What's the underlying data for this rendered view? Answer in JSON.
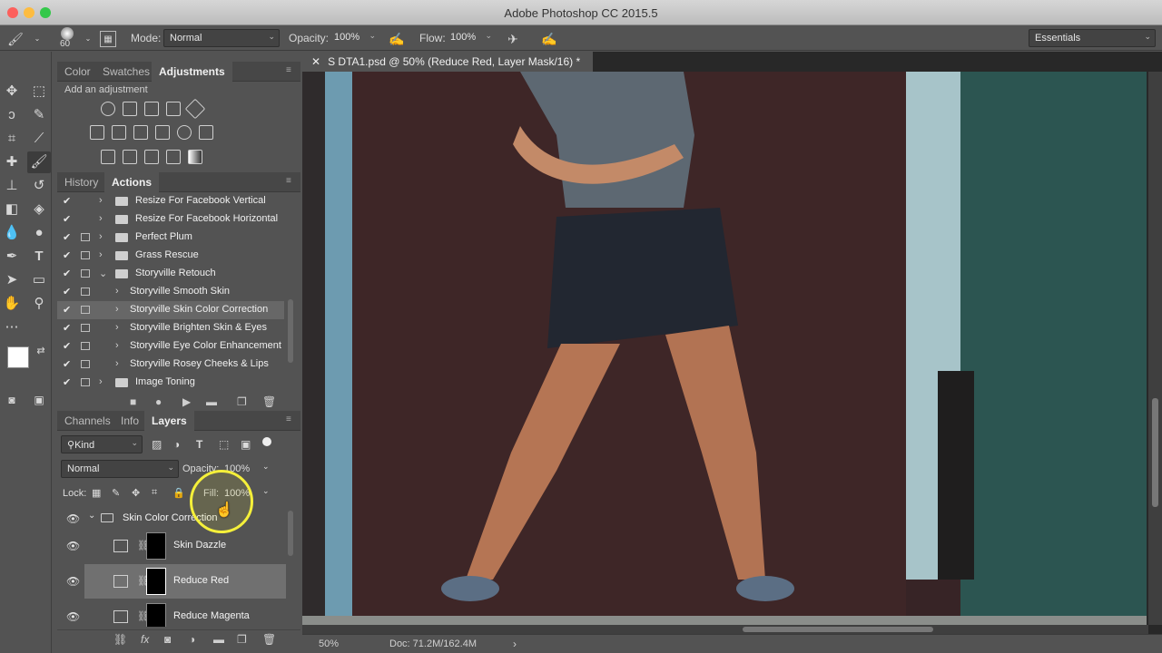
{
  "window": {
    "title": "Adobe Photoshop CC 2015.5"
  },
  "options_bar": {
    "brush_size": "60",
    "mode_label": "Mode:",
    "mode_value": "Normal",
    "opacity_label": "Opacity:",
    "opacity_value": "100%",
    "flow_label": "Flow:",
    "flow_value": "100%",
    "workspace": "Essentials"
  },
  "adjust_panel": {
    "tabs": [
      "Color",
      "Swatches",
      "Adjustments"
    ],
    "active_tab": "Adjustments",
    "heading": "Add an adjustment"
  },
  "actions_panel": {
    "tabs": [
      "History",
      "Actions"
    ],
    "active_tab": "Actions",
    "rows": [
      {
        "label": "Resize For Facebook Vertical"
      },
      {
        "label": "Resize For Facebook Horizontal"
      },
      {
        "label": "Perfect Plum"
      },
      {
        "label": "Grass Rescue"
      },
      {
        "label": "Storyville Retouch"
      },
      {
        "label": "Storyville Smooth Skin"
      },
      {
        "label": "Storyville Skin Color Correction"
      },
      {
        "label": "Storyville Brighten Skin & Eyes"
      },
      {
        "label": "Storyville Eye Color Enhancement"
      },
      {
        "label": "Storyville Rosey Cheeks & Lips"
      },
      {
        "label": "Image Toning"
      }
    ]
  },
  "layers_panel": {
    "tabs": [
      "Channels",
      "Info",
      "Layers"
    ],
    "active_tab": "Layers",
    "filter": "Kind",
    "blend_mode": "Normal",
    "opacity_label": "Opacity:",
    "opacity_value": "100%",
    "lock_label": "Lock:",
    "fill_label": "Fill:",
    "fill_value": "100%",
    "group": "Skin Color Correction",
    "layers": [
      {
        "name": "Skin Dazzle"
      },
      {
        "name": "Reduce Red"
      },
      {
        "name": "Reduce Magenta"
      }
    ]
  },
  "document": {
    "tab_title": "S DTA1.psd @ 50% (Reduce Red, Layer Mask/16) *",
    "zoom": "50%",
    "doc_info": "Doc: 71.2M/162.4M"
  },
  "colors": {
    "cursor_highlight": "#f5f03a",
    "panel_bg": "#535353"
  }
}
